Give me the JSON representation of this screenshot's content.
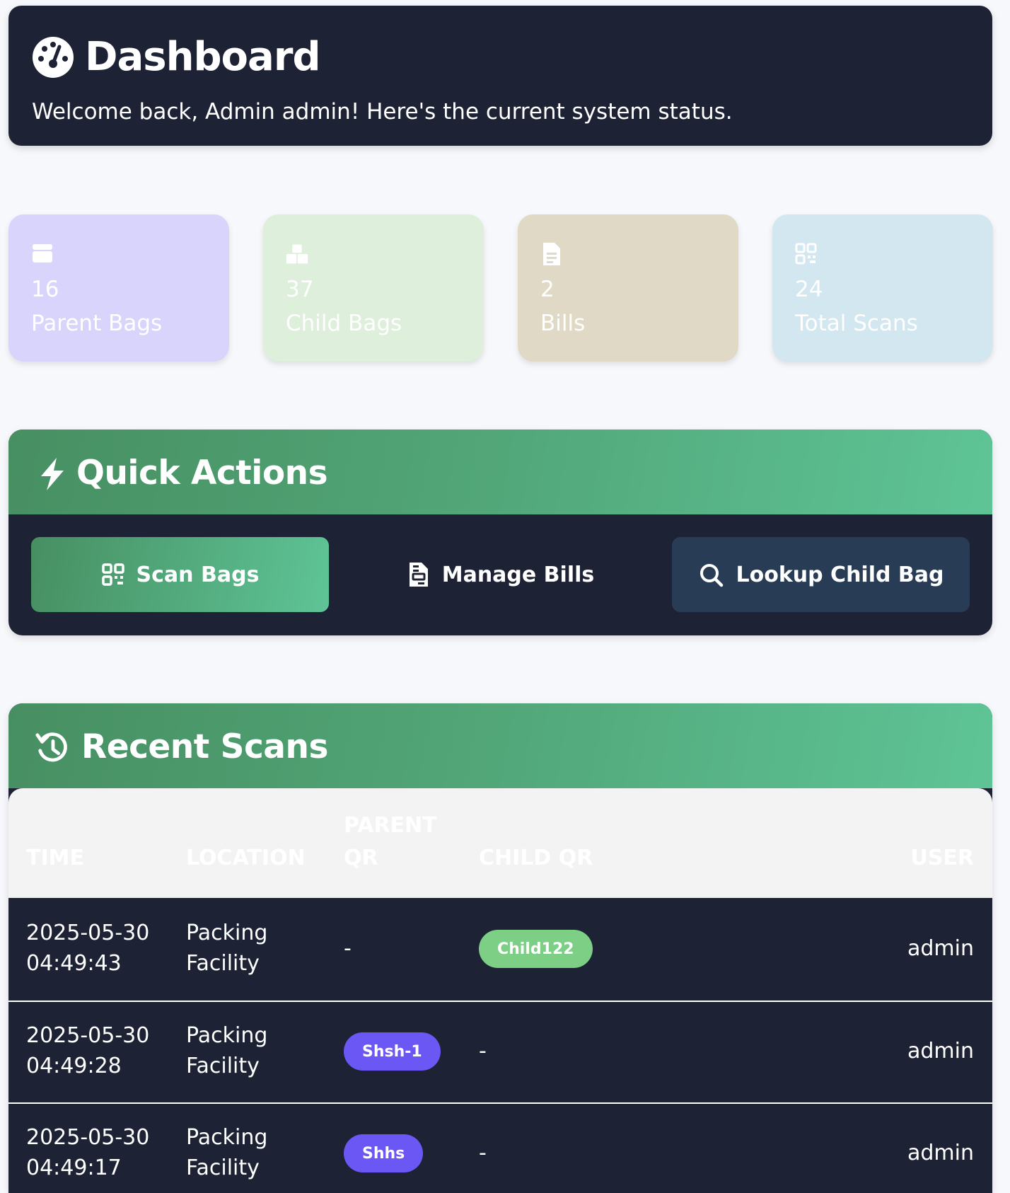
{
  "header": {
    "title": "Dashboard",
    "subtitle": "Welcome back, Admin admin! Here's the current system status.",
    "icon": "gauge-icon"
  },
  "stats": [
    {
      "value": "16",
      "label": "Parent Bags",
      "icon": "box-icon",
      "color": "#d9d4fb"
    },
    {
      "value": "37",
      "label": "Child Bags",
      "icon": "boxes-icon",
      "color": "#deefdc"
    },
    {
      "value": "2",
      "label": "Bills",
      "icon": "invoice-icon",
      "color": "#e0d9c5"
    },
    {
      "value": "24",
      "label": "Total Scans",
      "icon": "qrcode-icon",
      "color": "#d2e7ef"
    }
  ],
  "quick_actions": {
    "title": "Quick Actions",
    "icon": "bolt-icon",
    "buttons": [
      {
        "label": "Scan Bags",
        "icon": "qrcode-icon"
      },
      {
        "label": "Manage Bills",
        "icon": "invoice-icon"
      },
      {
        "label": "Lookup Child Bag",
        "icon": "search-icon"
      }
    ]
  },
  "recent_scans": {
    "title": "Recent Scans",
    "icon": "history-icon",
    "columns": {
      "time": "Time",
      "location": "Location",
      "parent_qr_1": "Parent",
      "parent_qr_2": "QR",
      "child_qr": "Child QR",
      "user": "User"
    },
    "rows": [
      {
        "date": "2025-05-30",
        "time": "04:49:43",
        "loc1": "Packing",
        "loc2": "Facility",
        "parent_qr": "-",
        "child_qr": "Child122",
        "user": "admin"
      },
      {
        "date": "2025-05-30",
        "time": "04:49:28",
        "loc1": "Packing",
        "loc2": "Facility",
        "parent_qr": "Shsh-1",
        "child_qr": "-",
        "user": "admin"
      },
      {
        "date": "2025-05-30",
        "time": "04:49:17",
        "loc1": "Packing",
        "loc2": "Facility",
        "parent_qr": "Shhs",
        "child_qr": "-",
        "user": "admin"
      }
    ]
  },
  "colors": {
    "dark": "#1e2235",
    "green_start": "#478f62",
    "green_end": "#5ec496",
    "child_pill": "#7ccf85",
    "parent_pill": "#6b57f3",
    "lookup_button": "#283d55"
  }
}
